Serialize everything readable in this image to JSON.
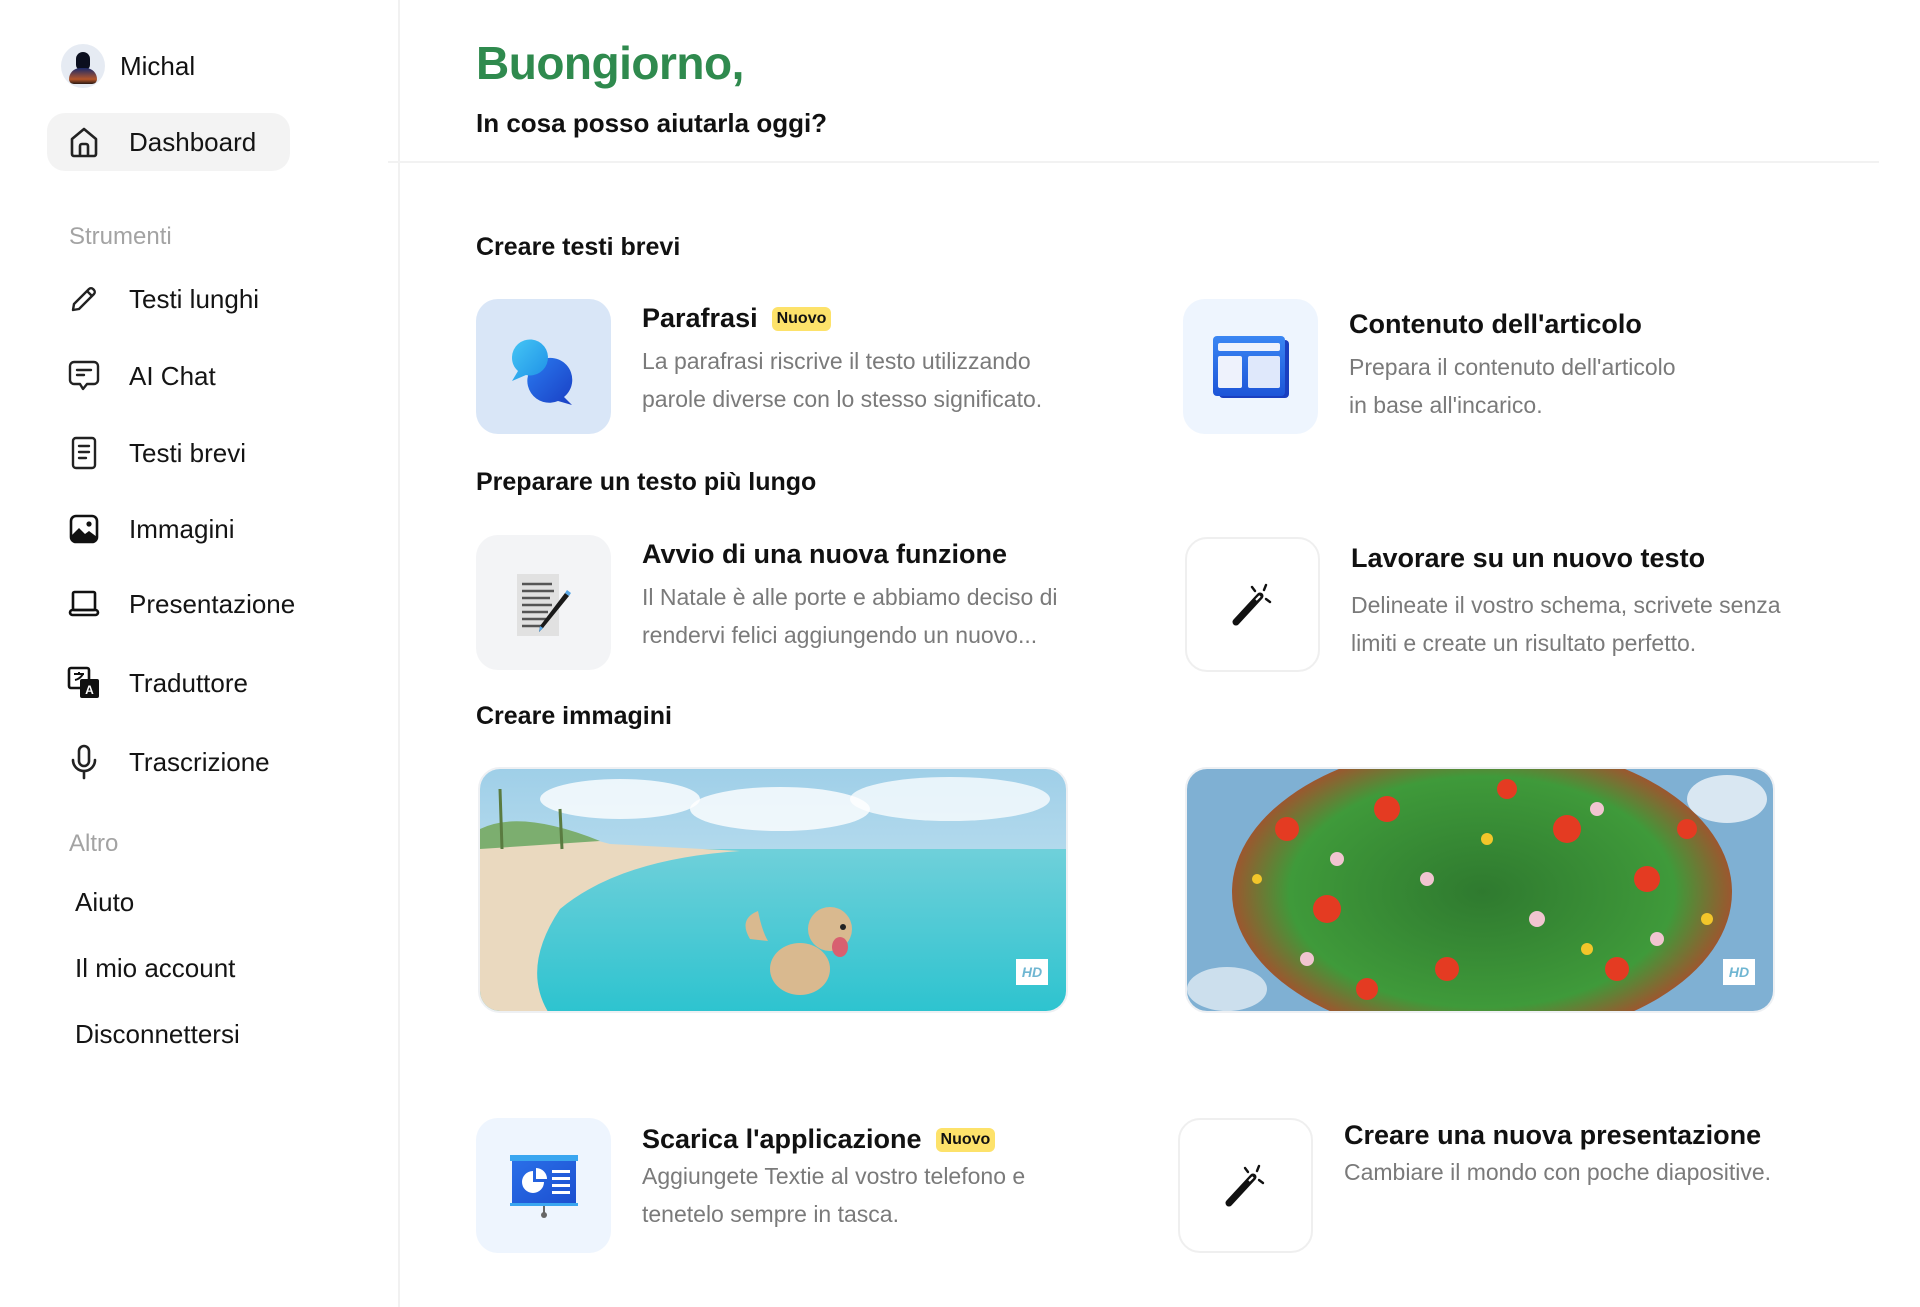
{
  "sidebar": {
    "user": {
      "name": "Michal"
    },
    "dashboard": {
      "label": "Dashboard",
      "icon": "home-icon"
    },
    "tools_label": "Strumenti",
    "tools": [
      {
        "label": "Testi lunghi",
        "icon": "pencil-icon"
      },
      {
        "label": "AI Chat",
        "icon": "chat-icon"
      },
      {
        "label": "Testi brevi",
        "icon": "document-icon"
      },
      {
        "label": "Immagini",
        "icon": "image-icon"
      },
      {
        "label": "Presentazione",
        "icon": "laptop-icon"
      },
      {
        "label": "Traduttore",
        "icon": "translate-icon"
      },
      {
        "label": "Trascrizione",
        "icon": "microphone-icon"
      }
    ],
    "other_label": "Altro",
    "other": [
      {
        "label": "Aiuto"
      },
      {
        "label": "Il mio account"
      },
      {
        "label": "Disconnettersi"
      }
    ]
  },
  "header": {
    "greeting": "Buongiorno,",
    "subtitle": "In cosa posso aiutarla oggi?",
    "accent_color": "#2f8a4e"
  },
  "sections": {
    "short": {
      "title": "Creare testi brevi",
      "cards": [
        {
          "title": "Parafrasi",
          "badge": "Nuovo",
          "desc1": "La parafrasi riscrive il testo utilizzando",
          "desc2": "parole diverse con lo stesso significato.",
          "icon": "speech-bubbles-icon"
        },
        {
          "title": "Contenuto dell'articolo",
          "desc1": "Prepara il contenuto dell'articolo",
          "desc2": "in base all'incarico.",
          "icon": "article-layout-icon"
        }
      ]
    },
    "long": {
      "title": "Preparare un testo più lungo",
      "cards": [
        {
          "title": "Avvio di una nuova funzione",
          "desc1": "Il Natale è alle porte e abbiamo deciso di",
          "desc2": "rendervi felici aggiungendo un nuovo...",
          "icon": "writing-pad-icon"
        },
        {
          "title": "Lavorare su un nuovo testo",
          "desc1": "Delineate il vostro schema, scrivete senza",
          "desc2": "limiti e create un risultato perfetto.",
          "icon": "magic-wand-icon"
        }
      ]
    },
    "images": {
      "title": "Creare immagini",
      "items": [
        {
          "alt": "Golden retriever on a tropical beach",
          "badge": "HD"
        },
        {
          "alt": "Sphere of colorful flowers in the sky",
          "badge": "HD"
        }
      ]
    },
    "more": {
      "cards": [
        {
          "title": "Scarica l'applicazione",
          "badge": "Nuovo",
          "desc1": "Aggiungete Textie al vostro telefono e",
          "desc2": "tenetelo sempre in tasca.",
          "icon": "presentation-board-icon"
        },
        {
          "title": "Creare una nuova presentazione",
          "desc1": "Cambiare il mondo con poche diapositive.",
          "icon": "magic-wand-icon"
        }
      ]
    }
  },
  "colors": {
    "badge": "#fde26a",
    "icon_blue": "#2b6fe0"
  }
}
